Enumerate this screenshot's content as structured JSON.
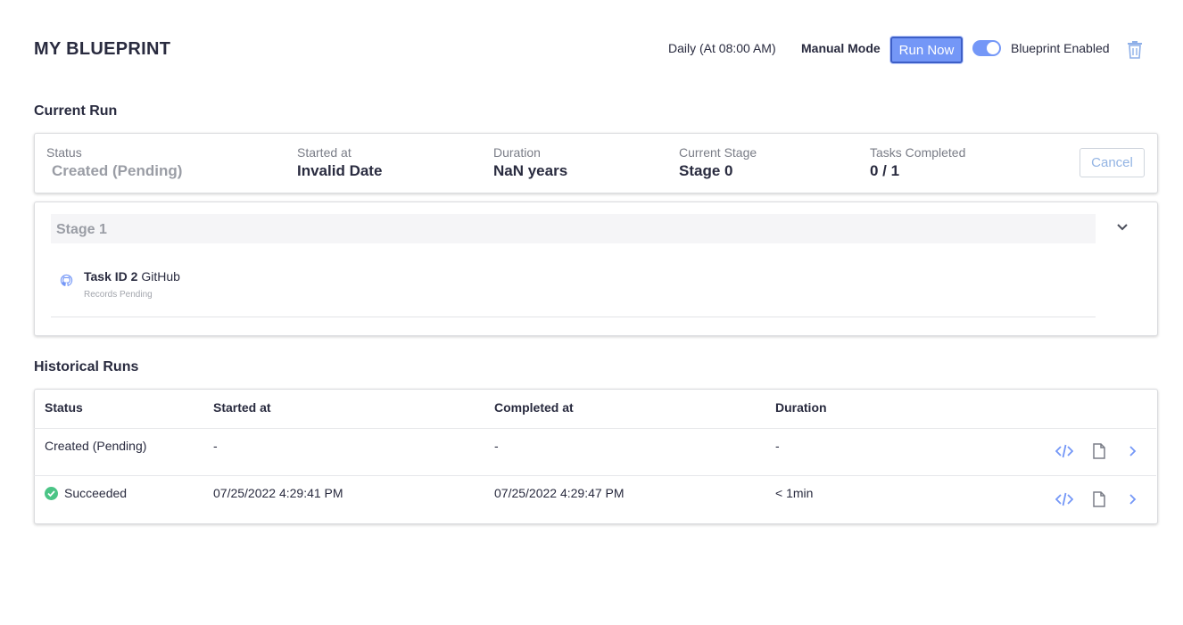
{
  "header": {
    "title": "MY BLUEPRINT",
    "schedule": "Daily (At 08:00 AM)",
    "mode": "Manual Mode",
    "run_now_label": "Run Now",
    "enabled_label": "Blueprint Enabled",
    "toggle_on": true
  },
  "current_run": {
    "section_title": "Current Run",
    "status_label": "Status",
    "status_value": "Created (Pending)",
    "started_label": "Started at",
    "started_value": "Invalid Date",
    "duration_label": "Duration",
    "duration_value": "NaN years",
    "stage_label": "Current Stage",
    "stage_value": "Stage 0",
    "tasks_label": "Tasks Completed",
    "tasks_value": "0 / 1",
    "cancel_label": "Cancel"
  },
  "stages": [
    {
      "title": "Stage 1",
      "tasks": [
        {
          "id_label": "Task ID 2",
          "plugin": "GitHub",
          "status": "Records Pending",
          "icon": "github-icon"
        }
      ]
    }
  ],
  "historical_runs": {
    "section_title": "Historical Runs",
    "columns": [
      "Status",
      "Started at",
      "Completed at",
      "Duration"
    ],
    "rows": [
      {
        "status": "Created (Pending)",
        "started": "-",
        "completed": "-",
        "duration": "-",
        "success": false
      },
      {
        "status": "Succeeded",
        "started": "07/25/2022 4:29:41 PM",
        "completed": "07/25/2022 4:29:47 PM",
        "duration": "< 1min",
        "success": true
      }
    ],
    "row_actions": [
      "code-icon",
      "file-icon",
      "chevron-right-icon"
    ]
  },
  "colors": {
    "accent": "#7497f7",
    "success": "#4bc486",
    "text": "#292b3f"
  }
}
